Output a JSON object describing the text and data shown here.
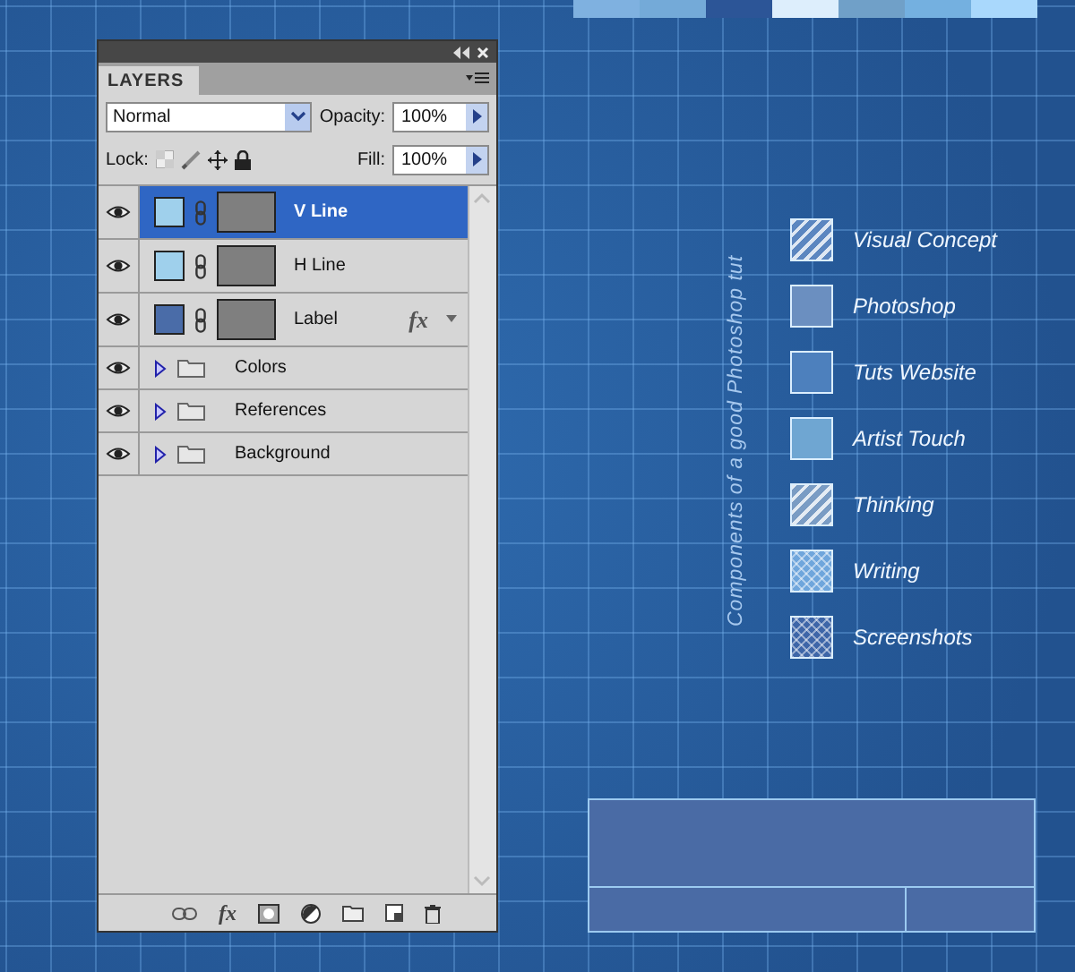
{
  "palette": [
    {
      "color": "#7fb1e0"
    },
    {
      "color": "#74aad8"
    },
    {
      "color": "#2c5597"
    },
    {
      "color": "#ddeefc"
    },
    {
      "color": "#70a0c8"
    },
    {
      "color": "#74b0e0"
    },
    {
      "color": "#a9d8fc"
    }
  ],
  "panel": {
    "tab": "LAYERS",
    "blend_mode": "Normal",
    "opacity_label": "Opacity:",
    "opacity": "100%",
    "lock_label": "Lock:",
    "fill_label": "Fill:",
    "fill": "100%",
    "layers": [
      {
        "kind": "layer",
        "name": "V Line",
        "color": "#9fd0ec",
        "selected": true,
        "fx": false
      },
      {
        "kind": "layer",
        "name": "H Line",
        "color": "#9fd0ec",
        "selected": false,
        "fx": false
      },
      {
        "kind": "layer",
        "name": "Label",
        "color": "#4a6ca8",
        "selected": false,
        "fx": true,
        "fx_label": "fx"
      },
      {
        "kind": "group",
        "name": "Colors",
        "selected": false
      },
      {
        "kind": "group",
        "name": "References",
        "selected": false
      },
      {
        "kind": "group",
        "name": "Background",
        "selected": false
      }
    ],
    "toolbar_fx": "fx"
  },
  "legend": {
    "title": "Components of a good Photoshop tut",
    "items": [
      {
        "label": "Visual Concept",
        "kind": "hatch",
        "color": "#5b86c0"
      },
      {
        "label": "Photoshop",
        "kind": "solid",
        "color": "#6b8fc0"
      },
      {
        "label": "Tuts Website",
        "kind": "solid",
        "color": "#4d80bd"
      },
      {
        "label": "Artist Touch",
        "kind": "solid",
        "color": "#6fa6d2"
      },
      {
        "label": "Thinking",
        "kind": "hatch",
        "color": "#7a9cc4"
      },
      {
        "label": "Writing",
        "kind": "checker",
        "color": "#6fa6dc"
      },
      {
        "label": "Screenshots",
        "kind": "checker",
        "color": "#3e66a8"
      }
    ]
  }
}
